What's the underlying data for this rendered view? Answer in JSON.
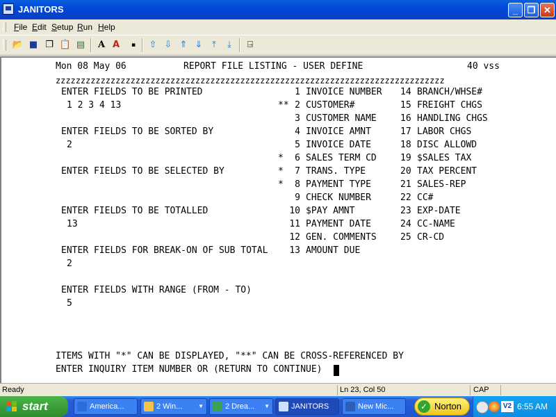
{
  "window": {
    "title": "JANITORS"
  },
  "menu": {
    "items": [
      {
        "pre": "",
        "u": "F",
        "post": "ile"
      },
      {
        "pre": "",
        "u": "E",
        "post": "dit"
      },
      {
        "pre": "",
        "u": "S",
        "post": "etup"
      },
      {
        "pre": "",
        "u": "R",
        "post": "un"
      },
      {
        "pre": "",
        "u": "H",
        "post": "elp"
      }
    ]
  },
  "toolbar": {
    "icons": [
      "open-folder-icon",
      "save-icon",
      "copy-icon",
      "paste-icon",
      "print-icon",
      "font-size-icon",
      "font-color-icon",
      "small-font-icon",
      "arrow-up-icon",
      "arrow-down-icon",
      "page-up-icon",
      "page-down-icon",
      "top-icon",
      "bottom-icon",
      "exit-door-icon"
    ]
  },
  "terminal": {
    "header": {
      "date": "Mon 08 May 06",
      "title": "REPORT FILE LISTING - USER DEFINE",
      "code": "40 vss"
    },
    "rule": "zzzzzzzzzzzzzzzzzzzzzzzzzzzzzzzzzzzzzzzzzzzzzzzzzzzzzzzzzzzzzzzzzzzzzzzzzzzzzz",
    "prompts": [
      {
        "label": "ENTER FIELDS TO BE PRINTED",
        "value": "1 2 3 4 13"
      },
      {
        "label": "ENTER FIELDS TO BE SORTED BY",
        "value": "2"
      },
      {
        "label": "ENTER FIELDS TO BE SELECTED BY",
        "value": ""
      },
      {
        "label": "ENTER FIELDS TO BE TOTALLED",
        "value": "13"
      },
      {
        "label": "ENTER FIELDS FOR BREAK-ON OF SUB TOTAL",
        "value": "2"
      },
      {
        "label": "ENTER FIELDS WITH RANGE (FROM - TO)",
        "value": "5"
      }
    ],
    "fields_left": [
      {
        "mark": "",
        "num": "1",
        "name": "INVOICE NUMBER"
      },
      {
        "mark": "**",
        "num": "2",
        "name": "CUSTOMER#"
      },
      {
        "mark": "",
        "num": "3",
        "name": "CUSTOMER NAME"
      },
      {
        "mark": "",
        "num": "4",
        "name": "INVOICE AMNT"
      },
      {
        "mark": "",
        "num": "5",
        "name": "INVOICE DATE"
      },
      {
        "mark": "*",
        "num": "6",
        "name": "SALES TERM CD"
      },
      {
        "mark": "*",
        "num": "7",
        "name": "TRANS. TYPE"
      },
      {
        "mark": "*",
        "num": "8",
        "name": "PAYMENT TYPE"
      },
      {
        "mark": "",
        "num": "9",
        "name": "CHECK NUMBER"
      },
      {
        "mark": "",
        "num": "10",
        "name": "$PAY AMNT"
      },
      {
        "mark": "",
        "num": "11",
        "name": "PAYMENT DATE"
      },
      {
        "mark": "",
        "num": "12",
        "name": "GEN. COMMENTS"
      },
      {
        "mark": "",
        "num": "13",
        "name": "AMOUNT DUE"
      }
    ],
    "fields_right": [
      {
        "num": "14",
        "name": "BRANCH/WHSE#"
      },
      {
        "num": "15",
        "name": "FREIGHT CHGS"
      },
      {
        "num": "16",
        "name": "HANDLING CHGS"
      },
      {
        "num": "17",
        "name": "LABOR CHGS"
      },
      {
        "num": "18",
        "name": "DISC ALLOWD"
      },
      {
        "num": "19",
        "name": "$SALES TAX"
      },
      {
        "num": "20",
        "name": "TAX PERCENT"
      },
      {
        "num": "21",
        "name": "SALES-REP"
      },
      {
        "num": "22",
        "name": "CC#"
      },
      {
        "num": "23",
        "name": "EXP-DATE"
      },
      {
        "num": "24",
        "name": "CC-NAME"
      },
      {
        "num": "25",
        "name": "CR-CD"
      }
    ],
    "footer_note": "ITEMS WITH \"*\" CAN BE DISPLAYED, \"**\" CAN BE CROSS-REFERENCED BY",
    "footer_prompt": "ENTER INQUIRY ITEM NUMBER OR (RETURN TO CONTINUE)"
  },
  "statusbar": {
    "ready": "Ready",
    "position": "Ln 23, Col 50",
    "caps": "CAP"
  },
  "taskbar": {
    "start": "start",
    "tasks": [
      {
        "label": "America...",
        "icon_color": "#2a6fd8",
        "active": false
      },
      {
        "label": "2 Win...",
        "icon_color": "#f2c44a",
        "active": false
      },
      {
        "label": "2 Drea...",
        "icon_color": "#3aa356",
        "active": false
      },
      {
        "label": "JANITORS",
        "icon_color": "#cfe0ff",
        "active": true
      },
      {
        "label": "New Mic...",
        "icon_color": "#2b5fb8",
        "active": false
      }
    ],
    "norton": "Norton",
    "tray_text": "V2",
    "clock": "6:55 AM"
  }
}
